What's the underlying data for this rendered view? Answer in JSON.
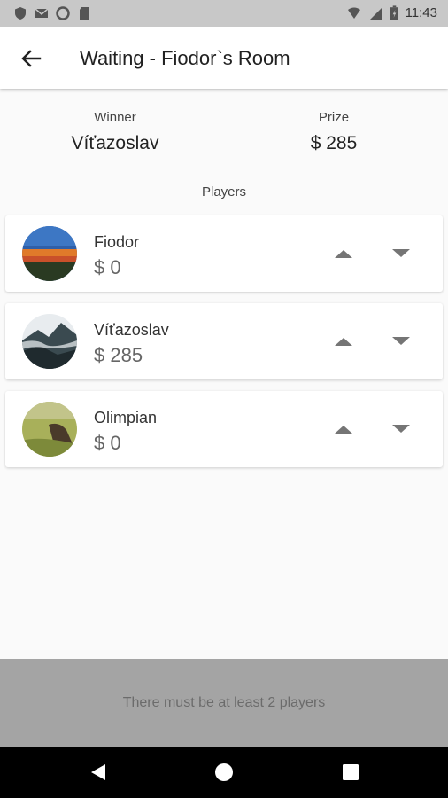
{
  "status_bar": {
    "time": "11:43",
    "icons": [
      "shield-icon",
      "mail-icon",
      "circle-icon",
      "sd-card-icon",
      "wifi-icon",
      "signal-icon",
      "battery-icon"
    ]
  },
  "app_bar": {
    "title": "Waiting - Fiodor`s Room",
    "back_icon": "arrow-back-icon"
  },
  "summary": {
    "winner_label": "Winner",
    "winner_name": "Víťazoslav",
    "prize_label": "Prize",
    "prize_value": "$ 285"
  },
  "players_heading": "Players",
  "players": [
    {
      "name": "Fiodor",
      "amount": "$ 0"
    },
    {
      "name": "Víťazoslav",
      "amount": "$ 285"
    },
    {
      "name": "Olimpian",
      "amount": "$ 0"
    }
  ],
  "action": {
    "label": "There must be at least 2 players"
  },
  "nav": {
    "icons": [
      "nav-back-icon",
      "nav-home-icon",
      "nav-recents-icon"
    ]
  },
  "colors": {
    "status_bar_bg": "#c8c8c8",
    "background": "#fafafa",
    "action_bar_bg": "#a4a4a4",
    "action_text": "#6b6b6b",
    "arrow": "#757575"
  }
}
